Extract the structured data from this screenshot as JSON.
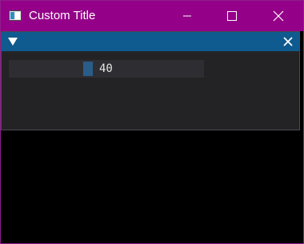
{
  "window": {
    "title": "Custom Title",
    "titlebar_color": "#940088",
    "buttons": {
      "minimize_icon": "minimize-icon",
      "maximize_icon": "maximize-icon",
      "close_icon": "close-icon"
    }
  },
  "panel": {
    "titlebar_color": "#0f5a8e",
    "collapse_icon": "triangle-down-icon",
    "close_icon": "close-icon",
    "slider": {
      "value": "40",
      "fraction": 0.4
    }
  }
}
